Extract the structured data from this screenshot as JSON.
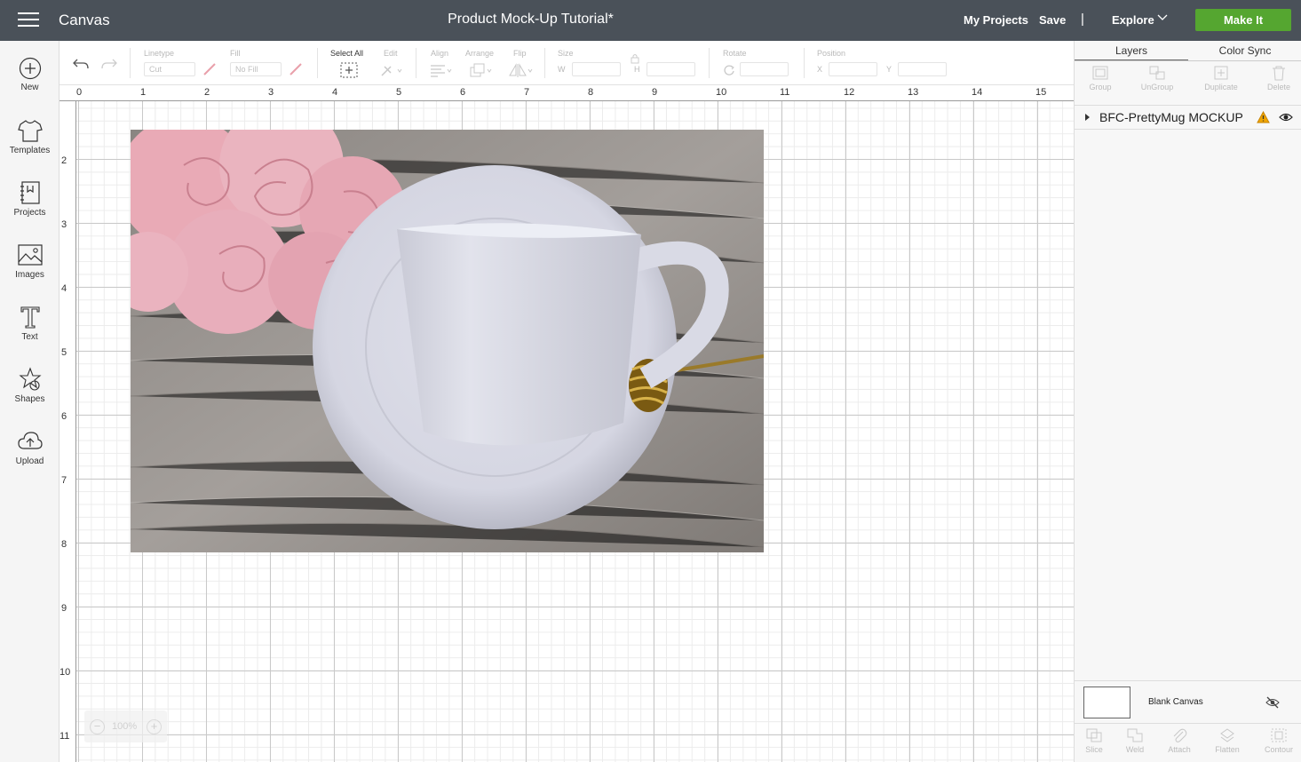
{
  "app": {
    "brand": "Canvas",
    "document_title": "Product Mock-Up Tutorial*"
  },
  "header": {
    "my_projects": "My Projects",
    "save": "Save",
    "separator": "|",
    "explore": "Explore",
    "make_it": "Make It"
  },
  "sidebar": {
    "items": [
      {
        "label": "New",
        "icon": "plus-circle-icon"
      },
      {
        "label": "Templates",
        "icon": "tshirt-icon"
      },
      {
        "label": "Projects",
        "icon": "notebook-icon"
      },
      {
        "label": "Images",
        "icon": "image-icon"
      },
      {
        "label": "Text",
        "icon": "text-icon"
      },
      {
        "label": "Shapes",
        "icon": "shapes-icon"
      },
      {
        "label": "Upload",
        "icon": "cloud-upload-icon"
      }
    ]
  },
  "toolbar": {
    "linetype_label": "Linetype",
    "linetype_value": "Cut",
    "fill_label": "Fill",
    "fill_value": "No Fill",
    "select_all_label": "Select All",
    "edit_label": "Edit",
    "align_label": "Align",
    "arrange_label": "Arrange",
    "flip_label": "Flip",
    "size_label": "Size",
    "w_label": "W",
    "h_label": "H",
    "rotate_label": "Rotate",
    "position_label": "Position",
    "x_label": "X",
    "y_label": "Y"
  },
  "rulers": {
    "top": [
      "0",
      "1",
      "2",
      "3",
      "4",
      "5",
      "6",
      "7",
      "8",
      "9",
      "10",
      "11",
      "12",
      "13",
      "14",
      "15"
    ],
    "left": [
      "2",
      "3",
      "4",
      "5",
      "6",
      "7",
      "8",
      "9",
      "10",
      "11"
    ]
  },
  "zoom": {
    "minus": "−",
    "value": "100%",
    "plus": "+"
  },
  "panel": {
    "tabs": [
      "Layers",
      "Color Sync"
    ],
    "actions": [
      "Group",
      "UnGroup",
      "Duplicate",
      "Delete"
    ],
    "layer_name": "BFC-PrettyMug MOCKUP",
    "blank_canvas": "Blank Canvas",
    "bottom_tools": [
      "Slice",
      "Weld",
      "Attach",
      "Flatten",
      "Contour"
    ]
  },
  "colors": {
    "header_bg": "#4a5159",
    "make_it": "#55a630",
    "warning": "#f0a500"
  }
}
